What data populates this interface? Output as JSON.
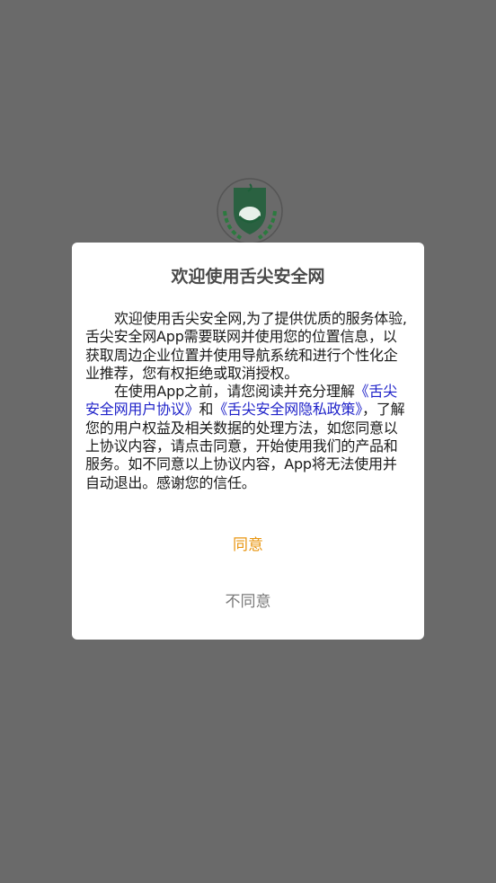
{
  "splash": {
    "logo_icon": "shield-leaf-logo-icon",
    "brand_color": "#1f6b3c"
  },
  "dialog": {
    "title": "欢迎使用舌尖安全网",
    "paragraph1": "欢迎使用舌尖安全网,为了提供优质的服务体验,舌尖安全网App需要联网并使用您的位置信息，以获取周边企业位置并使用导航系统和进行个性化企业推荐，您有权拒绝或取消授权。",
    "paragraph2_prefix": "在使用App之前，请您阅读并充分理解",
    "user_agreement_link": "《舌尖安全网用户协议》",
    "conjunction": "和",
    "privacy_policy_link": "《舌尖安全网隐私政策》",
    "paragraph2_suffix": "，了解您的用户权益及相关数据的处理方法，如您同意以上协议内容，请点击同意，开始使用我们的产品和服务。如不同意以上协议内容，App将无法使用并自动退出。感谢您的信任。",
    "agree_label": "同意",
    "disagree_label": "不同意"
  },
  "colors": {
    "overlay": "#6a6a6a",
    "link": "#1f22c9",
    "agree": "#e8950f",
    "disagree": "#7a7a7a"
  }
}
